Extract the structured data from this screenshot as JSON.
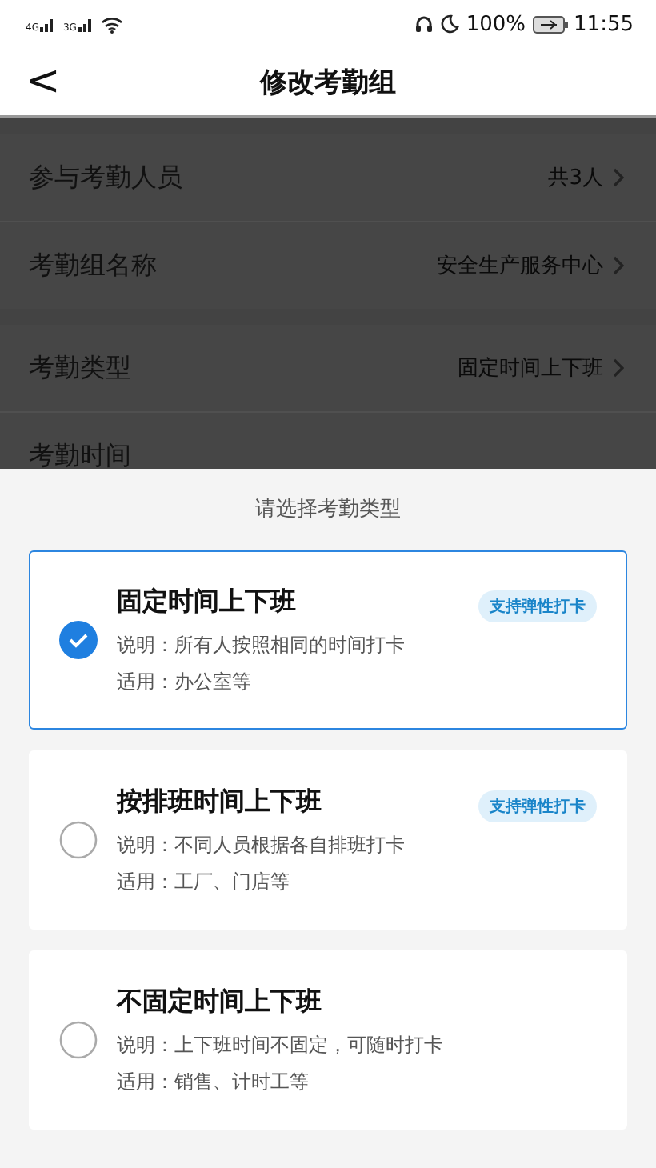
{
  "status_bar": {
    "networks": [
      "4G",
      "3G"
    ],
    "battery": "100%",
    "time": "11:55"
  },
  "header": {
    "back": "<",
    "title": "修改考勤组"
  },
  "settings": [
    {
      "label": "参与考勤人员",
      "value": "共3人",
      "group_start": true
    },
    {
      "label": "考勤组名称",
      "value": "安全生产服务中心",
      "group_start": false
    },
    {
      "label": "考勤类型",
      "value": "固定时间上下班",
      "group_start": true
    },
    {
      "label": "考勤时间",
      "group_start": false
    }
  ],
  "sheet": {
    "title": "请选择考勤类型",
    "options": [
      {
        "title": "固定时间上下班",
        "description": "说明：所有人按照相同的时间打卡",
        "usage": "适用：办公室等",
        "badge": "支持弹性打卡",
        "selected": true
      },
      {
        "title": "按排班时间上下班",
        "description": "说明：不同人员根据各自排班打卡",
        "usage": "适用：工厂、门店等",
        "badge": "支持弹性打卡",
        "selected": false
      },
      {
        "title": "不固定时间上下班",
        "description": "说明：上下班时间不固定，可随时打卡",
        "usage": "适用：销售、计时工等",
        "selected": false
      }
    ]
  }
}
